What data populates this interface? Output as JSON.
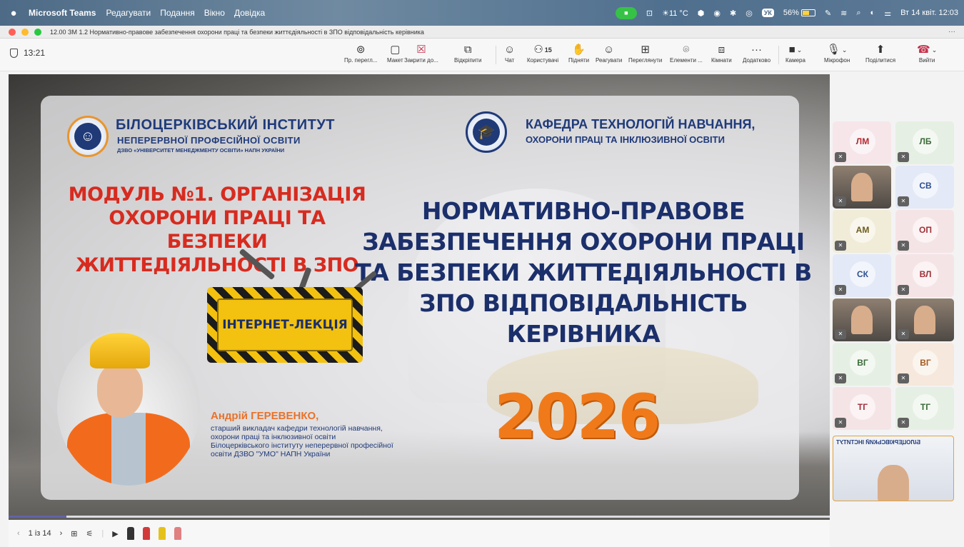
{
  "menubar": {
    "app_name": "Microsoft Teams",
    "menus": [
      "Редагувати",
      "Подання",
      "Вікно",
      "Довідка"
    ],
    "weather": "☀11 °C",
    "keyboard": "УК",
    "battery": "56%",
    "datetime": "Вт 14 квіт. 12:03"
  },
  "window": {
    "title": "12.00 ЗМ 1.2 Нормативно-правове забезпечення охорони праці та безпеки життєдіяльності в ЗПО відповідальність керівника",
    "more": "···"
  },
  "toolbar": {
    "timer": "13:21",
    "buttons": [
      {
        "label": "Пр. перегл...",
        "icon": "⊚"
      },
      {
        "label": "Макет",
        "icon": "▢"
      },
      {
        "label": "Закрити до...",
        "icon": "☒"
      },
      {
        "label": "Відкріпити",
        "icon": "⧉"
      },
      {
        "label": "Чат",
        "icon": "☺"
      },
      {
        "label": "Користувачі",
        "icon": "⚇",
        "count": "15"
      },
      {
        "label": "Підняти",
        "icon": "✋"
      },
      {
        "label": "Реагувати",
        "icon": "☺"
      },
      {
        "label": "Переглянути",
        "icon": "⊞"
      },
      {
        "label": "Елементи ...",
        "icon": "⌾"
      },
      {
        "label": "Кімнати",
        "icon": "⧈"
      },
      {
        "label": "Додатково",
        "icon": "···"
      },
      {
        "label": "Камера",
        "icon": "■"
      },
      {
        "label": "Мікрофон",
        "icon": "🎙"
      },
      {
        "label": "Поділитися",
        "icon": "⬆"
      },
      {
        "label": "Вийти",
        "icon": "☎"
      }
    ]
  },
  "slide": {
    "institute_line1": "БІЛОЦЕРКІВСЬКИЙ ІНСТИТУТ",
    "institute_line2": "НЕПЕРЕРВНОЇ ПРОФЕСІЙНОЇ ОСВІТИ",
    "institute_line3": "ДЗВО «УНІВЕРСИТЕТ МЕНЕДЖМЕНТУ ОСВІТИ» НАПН УКРАЇНИ",
    "department_line1": "КАФЕДРА ТЕХНОЛОГІЙ НАВЧАННЯ,",
    "department_line2": "ОХОРОНИ ПРАЦІ ТА ІНКЛЮЗИВНОЇ ОСВІТИ",
    "module_title": "МОДУЛЬ №1. ОРГАНІЗАЦІЯ ОХОРОНИ ПРАЦІ ТА БЕЗПЕКИ ЖИТТЕДІЯЛЬНОСТІ В ЗПО",
    "main_title": "НОРМАТИВНО-ПРАВОВЕ ЗАБЕЗПЕЧЕННЯ ОХОРОНИ ПРАЦІ ТА БЕЗПЕКИ ЖИТТЕДІЯЛЬНОСТІ В ЗПО ВІДПОВІДАЛЬНІСТЬ КЕРІВНИКА",
    "badge": "ІНТЕРНЕТ-ЛЕКЦІЯ",
    "lecturer_name": "Андрій ГЕРЕВЕНКО,",
    "lecturer_role": [
      "старший викладач кафедри технологій навчання,",
      "охорони праці та інклюзивної освіти",
      " Білоцерківського інституту неперервної професійної",
      "освіти ДЗВО \"УМО\" НАПН України"
    ],
    "year": "2026"
  },
  "bottombar": {
    "page_indicator": "1 із 14",
    "progress_fraction": 0.07,
    "pen_colors": [
      "#333333",
      "#555555",
      "#d23a3a",
      "#e5c21a",
      "#e08080"
    ]
  },
  "participants": [
    {
      "initials": "ЛМ",
      "color": "#b3272f",
      "bg": "#f6e6ea"
    },
    {
      "initials": "ЛБ",
      "color": "#3c6b3a",
      "bg": "#e6efe3"
    },
    {
      "initials": "",
      "video": true
    },
    {
      "initials": "СВ",
      "color": "#2e5090",
      "bg": "#e3e9f6"
    },
    {
      "initials": "АМ",
      "color": "#6b5c1f",
      "bg": "#f1ecd8"
    },
    {
      "initials": "ОП",
      "color": "#a0313a",
      "bg": "#f5e4e6"
    },
    {
      "initials": "СК",
      "color": "#2e5090",
      "bg": "#e3e9f6"
    },
    {
      "initials": "ВЛ",
      "color": "#a0313a",
      "bg": "#f5e4e6"
    },
    {
      "initials": "",
      "video": true
    },
    {
      "initials": "",
      "video": true
    },
    {
      "initials": "ВГ",
      "color": "#3c6b3a",
      "bg": "#e6efe3"
    },
    {
      "initials": "ВГ",
      "color": "#a8591c",
      "bg": "#f6e8dc"
    },
    {
      "initials": "ТГ",
      "color": "#a0313a",
      "bg": "#f5e4e6"
    },
    {
      "initials": "ТГ",
      "color": "#3c6b3a",
      "bg": "#e6efe3"
    }
  ],
  "self_view_mirror_text": "БІЛОЦЕРКІВСЬКИЙ ІНСТИТУТ",
  "colors": {
    "teams_accent": "#6264a7",
    "leave": "#c4314b",
    "camera_on": "#36c246"
  }
}
